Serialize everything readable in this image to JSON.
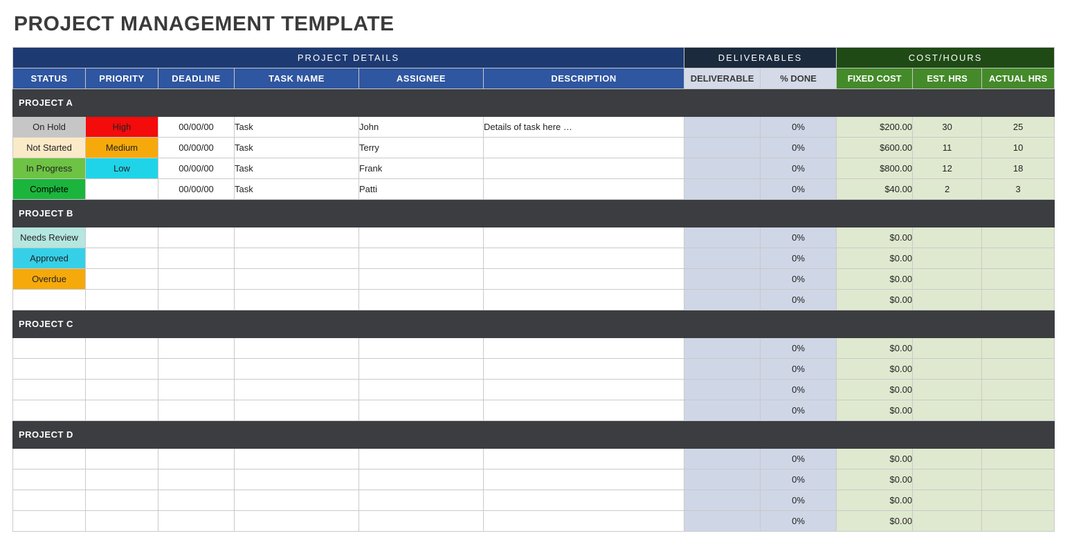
{
  "title": "PROJECT MANAGEMENT TEMPLATE",
  "sections": {
    "project_details": "PROJECT DETAILS",
    "deliverables": "DELIVERABLES",
    "cost_hours": "COST/HOURS"
  },
  "columns": {
    "status": "STATUS",
    "priority": "PRIORITY",
    "deadline": "DEADLINE",
    "task_name": "TASK NAME",
    "assignee": "ASSIGNEE",
    "description": "DESCRIPTION",
    "deliverable": "DELIVERABLE",
    "pct_done": "% DONE",
    "fixed_cost": "FIXED COST",
    "est_hrs": "EST. HRS",
    "actual_hrs": "ACTUAL HRS"
  },
  "status_classes": {
    "On Hold": "st-onhold",
    "Not Started": "st-notstarted",
    "In Progress": "st-inprogress",
    "Complete": "st-complete",
    "Needs Review": "st-needsreview",
    "Approved": "st-approved",
    "Overdue": "st-overdue"
  },
  "priority_classes": {
    "High": "pr-high",
    "Medium": "pr-medium",
    "Low": "pr-low"
  },
  "groups": [
    {
      "name": "PROJECT A",
      "rows": [
        {
          "status": "On Hold",
          "priority": "High",
          "deadline": "00/00/00",
          "task": "Task",
          "assignee": "John",
          "desc": "Details of task here …",
          "deliverable": "",
          "done": "0%",
          "fixed": "$200.00",
          "est": "30",
          "act": "25"
        },
        {
          "status": "Not Started",
          "priority": "Medium",
          "deadline": "00/00/00",
          "task": "Task",
          "assignee": "Terry",
          "desc": "",
          "deliverable": "",
          "done": "0%",
          "fixed": "$600.00",
          "est": "11",
          "act": "10"
        },
        {
          "status": "In Progress",
          "priority": "Low",
          "deadline": "00/00/00",
          "task": "Task",
          "assignee": "Frank",
          "desc": "",
          "deliverable": "",
          "done": "0%",
          "fixed": "$800.00",
          "est": "12",
          "act": "18"
        },
        {
          "status": "Complete",
          "priority": "",
          "deadline": "00/00/00",
          "task": "Task",
          "assignee": "Patti",
          "desc": "",
          "deliverable": "",
          "done": "0%",
          "fixed": "$40.00",
          "est": "2",
          "act": "3"
        }
      ]
    },
    {
      "name": "PROJECT B",
      "rows": [
        {
          "status": "Needs Review",
          "priority": "",
          "deadline": "",
          "task": "",
          "assignee": "",
          "desc": "",
          "deliverable": "",
          "done": "0%",
          "fixed": "$0.00",
          "est": "",
          "act": ""
        },
        {
          "status": "Approved",
          "priority": "",
          "deadline": "",
          "task": "",
          "assignee": "",
          "desc": "",
          "deliverable": "",
          "done": "0%",
          "fixed": "$0.00",
          "est": "",
          "act": ""
        },
        {
          "status": "Overdue",
          "priority": "",
          "deadline": "",
          "task": "",
          "assignee": "",
          "desc": "",
          "deliverable": "",
          "done": "0%",
          "fixed": "$0.00",
          "est": "",
          "act": ""
        },
        {
          "status": "",
          "priority": "",
          "deadline": "",
          "task": "",
          "assignee": "",
          "desc": "",
          "deliverable": "",
          "done": "0%",
          "fixed": "$0.00",
          "est": "",
          "act": ""
        }
      ]
    },
    {
      "name": "PROJECT C",
      "rows": [
        {
          "status": "",
          "priority": "",
          "deadline": "",
          "task": "",
          "assignee": "",
          "desc": "",
          "deliverable": "",
          "done": "0%",
          "fixed": "$0.00",
          "est": "",
          "act": ""
        },
        {
          "status": "",
          "priority": "",
          "deadline": "",
          "task": "",
          "assignee": "",
          "desc": "",
          "deliverable": "",
          "done": "0%",
          "fixed": "$0.00",
          "est": "",
          "act": ""
        },
        {
          "status": "",
          "priority": "",
          "deadline": "",
          "task": "",
          "assignee": "",
          "desc": "",
          "deliverable": "",
          "done": "0%",
          "fixed": "$0.00",
          "est": "",
          "act": ""
        },
        {
          "status": "",
          "priority": "",
          "deadline": "",
          "task": "",
          "assignee": "",
          "desc": "",
          "deliverable": "",
          "done": "0%",
          "fixed": "$0.00",
          "est": "",
          "act": ""
        }
      ]
    },
    {
      "name": "PROJECT D",
      "rows": [
        {
          "status": "",
          "priority": "",
          "deadline": "",
          "task": "",
          "assignee": "",
          "desc": "",
          "deliverable": "",
          "done": "0%",
          "fixed": "$0.00",
          "est": "",
          "act": ""
        },
        {
          "status": "",
          "priority": "",
          "deadline": "",
          "task": "",
          "assignee": "",
          "desc": "",
          "deliverable": "",
          "done": "0%",
          "fixed": "$0.00",
          "est": "",
          "act": ""
        },
        {
          "status": "",
          "priority": "",
          "deadline": "",
          "task": "",
          "assignee": "",
          "desc": "",
          "deliverable": "",
          "done": "0%",
          "fixed": "$0.00",
          "est": "",
          "act": ""
        },
        {
          "status": "",
          "priority": "",
          "deadline": "",
          "task": "",
          "assignee": "",
          "desc": "",
          "deliverable": "",
          "done": "0%",
          "fixed": "$0.00",
          "est": "",
          "act": ""
        }
      ]
    }
  ]
}
